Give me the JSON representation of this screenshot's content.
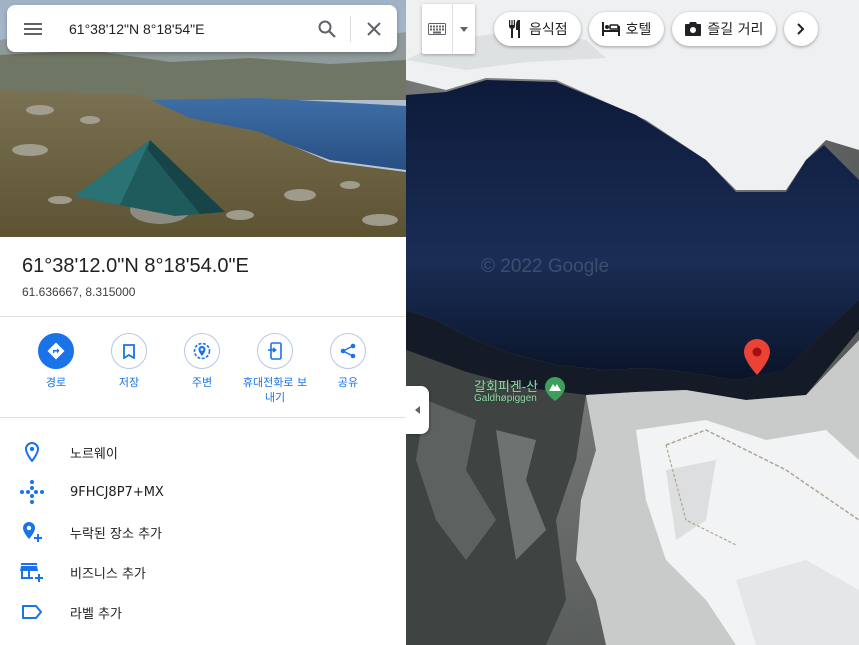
{
  "search": {
    "query": "61°38'12\"N 8°18'54\"E",
    "menu_icon": "hamburger-menu-icon",
    "search_icon": "search-icon",
    "close_icon": "close-icon"
  },
  "place": {
    "title": "61°38'12.0\"N 8°18'54.0\"E",
    "decimal": "61.636667, 8.315000"
  },
  "actions": [
    {
      "label": "경로",
      "icon": "directions-icon"
    },
    {
      "label": "저장",
      "icon": "bookmark-icon"
    },
    {
      "label": "주변",
      "icon": "nearby-icon"
    },
    {
      "label": "휴대전화로 보내기",
      "icon": "send-to-phone-icon"
    },
    {
      "label": "공유",
      "icon": "share-icon"
    }
  ],
  "info": [
    {
      "text": "노르웨이",
      "icon": "location-pin-icon"
    },
    {
      "text": "9FHCJ8P7+MX",
      "icon": "plus-code-icon"
    },
    {
      "text": "누락된 장소 추가",
      "icon": "add-place-icon"
    },
    {
      "text": "비즈니스 추가",
      "icon": "add-business-icon"
    },
    {
      "text": "라벨 추가",
      "icon": "label-icon"
    }
  ],
  "map": {
    "chips": [
      {
        "label": "음식점",
        "icon": "restaurant-icon"
      },
      {
        "label": "호텔",
        "icon": "hotel-icon"
      },
      {
        "label": "즐길 거리",
        "icon": "camera-icon"
      }
    ],
    "watermark": "© 2022 Google",
    "peak_label": "갈회피겐-산",
    "peak_sub": "Galdhøpiggen",
    "marker_color": "#ea4335"
  },
  "colors": {
    "accent": "#1a73e8",
    "text": "#202124"
  }
}
